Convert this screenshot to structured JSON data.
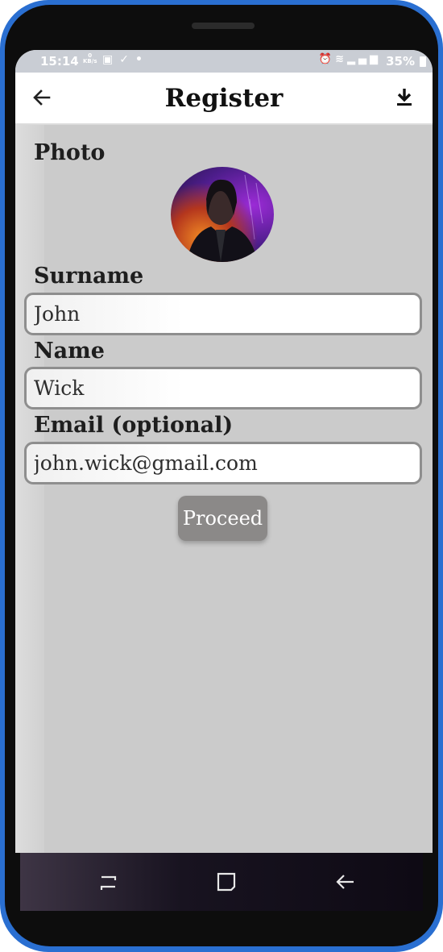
{
  "status_bar": {
    "time": "15:14",
    "network_speed": "0",
    "network_unit": "KB/s",
    "battery": "35%"
  },
  "app_bar": {
    "title": "Register",
    "back_icon": "arrow-left-icon",
    "download_icon": "download-icon"
  },
  "form": {
    "photo_label": "Photo",
    "surname_label": "Surname",
    "surname_value": "John",
    "name_label": "Name",
    "name_value": "Wick",
    "email_label": "Email (optional)",
    "email_value": "john.wick@gmail.com",
    "proceed_label": "Proceed"
  },
  "nav_bar": {
    "recent_icon": "recent-apps-icon",
    "home_icon": "home-icon",
    "back_icon": "back-icon"
  },
  "colors": {
    "screen_background": "#cbcbcb",
    "frame_accent": "#2a6fd1",
    "button_background": "#8b8988"
  }
}
